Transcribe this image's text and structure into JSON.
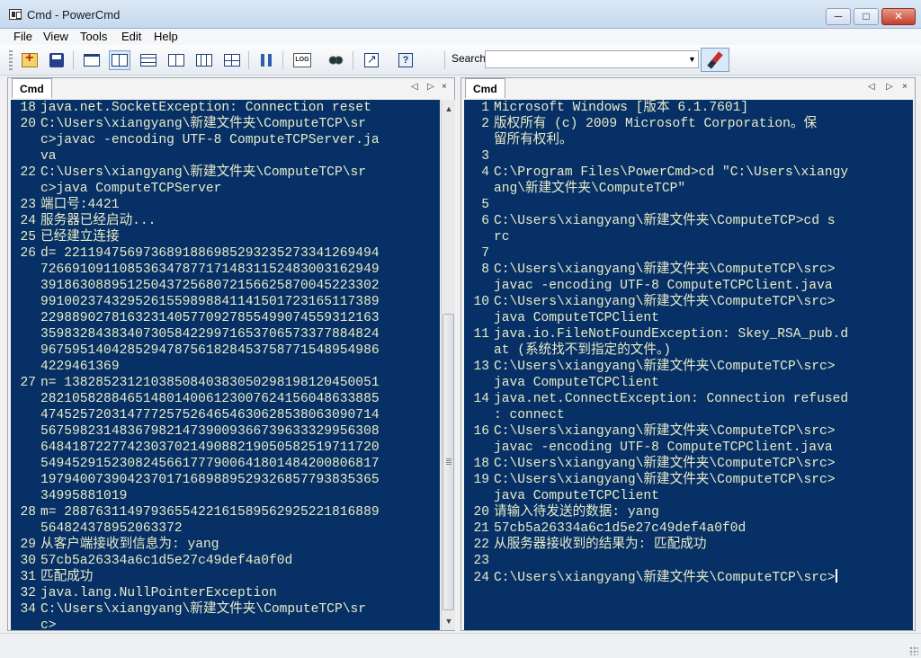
{
  "window": {
    "title": "Cmd - PowerCmd",
    "min": "─",
    "max": "□",
    "close": "✕"
  },
  "menu": [
    "File",
    "View",
    "Tools",
    "Edit",
    "Help"
  ],
  "toolbar": {
    "icons": [
      "new-console-icon",
      "save-icon",
      "layout-single-icon",
      "layout-two-columns-icon",
      "layout-three-rows-icon",
      "layout-split-icon",
      "layout-three-columns-icon",
      "layout-grid-icon",
      "pause-icon",
      "log-icon",
      "gears-icon",
      "export-icon",
      "help-icon",
      "brush-icon"
    ],
    "log_text": "LOG",
    "help_text": "?",
    "search_label": "Search",
    "search_value": "",
    "dropdown": "▼"
  },
  "left_pane": {
    "tab": "Cmd",
    "nav": [
      "◁",
      "▷",
      "×"
    ],
    "lines": [
      {
        "n": "18",
        "t": "java.net.SocketException: Connection reset"
      },
      {
        "n": "20",
        "t": "C:\\Users\\xiangyang\\新建文件夹\\ComputeTCP\\sr"
      },
      {
        "n": "",
        "t": "c>javac -encoding UTF-8 ComputeTCPServer.ja"
      },
      {
        "n": "",
        "t": "va"
      },
      {
        "n": "22",
        "t": "C:\\Users\\xiangyang\\新建文件夹\\ComputeTCP\\sr"
      },
      {
        "n": "",
        "t": "c>java ComputeTCPServer"
      },
      {
        "n": "23",
        "t": "端口号:4421"
      },
      {
        "n": "24",
        "t": "服务器已经启动..."
      },
      {
        "n": "25",
        "t": "已经建立连接"
      },
      {
        "n": "26",
        "t": "d= 22119475697368918869852932352733412694​94"
      },
      {
        "n": "",
        "t": "726691091108536347877171483115248300316294​9"
      },
      {
        "n": "",
        "t": "391863088951250437256807215662587004522330​2"
      },
      {
        "n": "",
        "t": "991002374329526155989884114150172316511738​9"
      },
      {
        "n": "",
        "t": "229889027816323140577092785549907455931216​3"
      },
      {
        "n": "",
        "t": "359832843834073058422997165370657337788482​4"
      },
      {
        "n": "",
        "t": "967595140428529478756182845375877154895498​6"
      },
      {
        "n": "",
        "t": "4229461369"
      },
      {
        "n": "27",
        "t": "n= 13828523121038508403830502981981204500​51"
      },
      {
        "n": "",
        "t": "282105828846514801400612300762415604863388​5"
      },
      {
        "n": "",
        "t": "474525720314777257526465463062853806309071​4"
      },
      {
        "n": "",
        "t": "567598231483679821473900936673963332995630​8"
      },
      {
        "n": "",
        "t": "648418722774230370214908821905058251971172​0"
      },
      {
        "n": "",
        "t": "549452915230824566177790064180148420080681​7"
      },
      {
        "n": "",
        "t": "197940073904237017168988952932685779383536​5"
      },
      {
        "n": "",
        "t": "34995881019"
      },
      {
        "n": "28",
        "t": "m= 28876311497936554221615895629252218168​89"
      },
      {
        "n": "",
        "t": "564824378952063372"
      },
      {
        "n": "29",
        "t": "从客户端接收到信息为: yang"
      },
      {
        "n": "30",
        "t": "57cb5a26334a6c1d5e27c49def4a0f0d"
      },
      {
        "n": "31",
        "t": "匹配成功"
      },
      {
        "n": "32",
        "t": "java.lang.NullPointerException"
      },
      {
        "n": "34",
        "t": "C:\\Users\\xiangyang\\新建文件夹\\ComputeTCP\\sr"
      },
      {
        "n": "",
        "t": "c>"
      }
    ],
    "scroll_up": "▲",
    "scroll_down": "▼"
  },
  "right_pane": {
    "tab": "Cmd",
    "nav": [
      "◁",
      "▷",
      "×"
    ],
    "lines": [
      {
        "n": "1",
        "t": "Microsoft Windows [版本 6.1.7601]"
      },
      {
        "n": "2",
        "t": "版权所有 (c) 2009 Microsoft Corporation。保"
      },
      {
        "n": "",
        "t": "留所有权利。"
      },
      {
        "n": "3",
        "t": ""
      },
      {
        "n": "4",
        "t": "C:\\Program Files\\PowerCmd>cd \"C:\\Users\\xiangy"
      },
      {
        "n": "",
        "t": "ang\\新建文件夹\\ComputeTCP\""
      },
      {
        "n": "5",
        "t": ""
      },
      {
        "n": "6",
        "t": "C:\\Users\\xiangyang\\新建文件夹\\ComputeTCP>cd s"
      },
      {
        "n": "",
        "t": "rc"
      },
      {
        "n": "7",
        "t": ""
      },
      {
        "n": "8",
        "t": "C:\\Users\\xiangyang\\新建文件夹\\ComputeTCP\\src>"
      },
      {
        "n": "",
        "t": "javac -encoding UTF-8 ComputeTCPClient.java"
      },
      {
        "n": "10",
        "t": "C:\\Users\\xiangyang\\新建文件夹\\ComputeTCP\\src>"
      },
      {
        "n": "",
        "t": "java ComputeTCPClient"
      },
      {
        "n": "11",
        "t": "java.io.FileNotFoundException: Skey_RSA_pub.d"
      },
      {
        "n": "",
        "t": "at (系统找不到指定的文件。)"
      },
      {
        "n": "13",
        "t": "C:\\Users\\xiangyang\\新建文件夹\\ComputeTCP\\src>"
      },
      {
        "n": "",
        "t": "java ComputeTCPClient"
      },
      {
        "n": "14",
        "t": "java.net.ConnectException: Connection refused"
      },
      {
        "n": "",
        "t": ": connect"
      },
      {
        "n": "16",
        "t": "C:\\Users\\xiangyang\\新建文件夹\\ComputeTCP\\src>"
      },
      {
        "n": "",
        "t": "javac -encoding UTF-8 ComputeTCPClient.java"
      },
      {
        "n": "18",
        "t": "C:\\Users\\xiangyang\\新建文件夹\\ComputeTCP\\src>"
      },
      {
        "n": "19",
        "t": "C:\\Users\\xiangyang\\新建文件夹\\ComputeTCP\\src>"
      },
      {
        "n": "",
        "t": "java ComputeTCPClient"
      },
      {
        "n": "20",
        "t": "请输入待发送的数据: yang"
      },
      {
        "n": "21",
        "t": "57cb5a26334a6c1d5e27c49def4a0f0d"
      },
      {
        "n": "22",
        "t": "从服务器接收到的结果为: 匹配成功"
      },
      {
        "n": "23",
        "t": ""
      },
      {
        "n": "24",
        "t": "C:\\Users\\xiangyang\\新建文件夹\\ComputeTCP\\src>"
      }
    ]
  }
}
